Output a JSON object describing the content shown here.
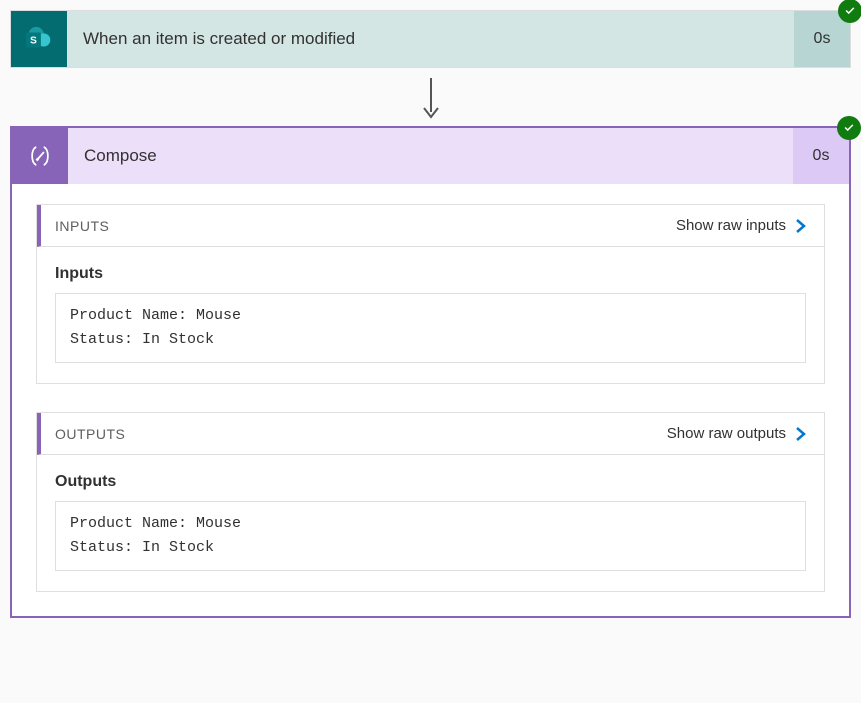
{
  "trigger": {
    "title": "When an item is created or modified",
    "duration": "0s",
    "status": "success"
  },
  "compose": {
    "title": "Compose",
    "duration": "0s",
    "status": "success",
    "inputs": {
      "header": "INPUTS",
      "raw_link": "Show raw inputs",
      "subtitle": "Inputs",
      "content": "Product Name: Mouse\nStatus: In Stock"
    },
    "outputs": {
      "header": "OUTPUTS",
      "raw_link": "Show raw outputs",
      "subtitle": "Outputs",
      "content": "Product Name: Mouse\nStatus: In Stock"
    }
  }
}
